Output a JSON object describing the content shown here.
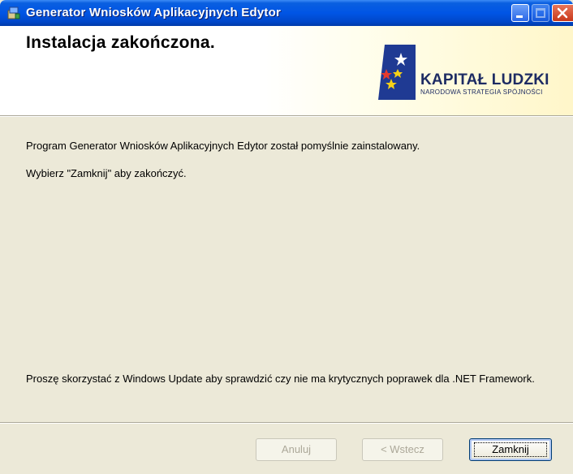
{
  "window": {
    "title": "Generator Wniosków Aplikacyjnych Edytor",
    "controls": [
      "minimize-icon",
      "maximize-icon",
      "close-icon"
    ]
  },
  "header": {
    "title": "Instalacja zakończona.",
    "logo_text": "KAPITAŁ LUDZKI",
    "logo_subtext": "NARODOWA STRATEGIA SPÓJNOŚCI"
  },
  "body": {
    "message_installed": "Program Generator Wniosków Aplikacyjnych Edytor został pomyślnie zainstalowany.",
    "message_close": "Wybierz \"Zamknij\" aby zakończyć.",
    "message_update": "Proszę skorzystać z Windows Update aby sprawdzić czy nie ma krytycznych poprawek dla .NET Framework."
  },
  "buttons": {
    "cancel": "Anuluj",
    "back": "< Wstecz",
    "close": "Zamknij"
  },
  "colors": {
    "titlebar": "#0055E5",
    "dialog_bg": "#ECE9D8",
    "logo_text": "#1D2B63"
  }
}
